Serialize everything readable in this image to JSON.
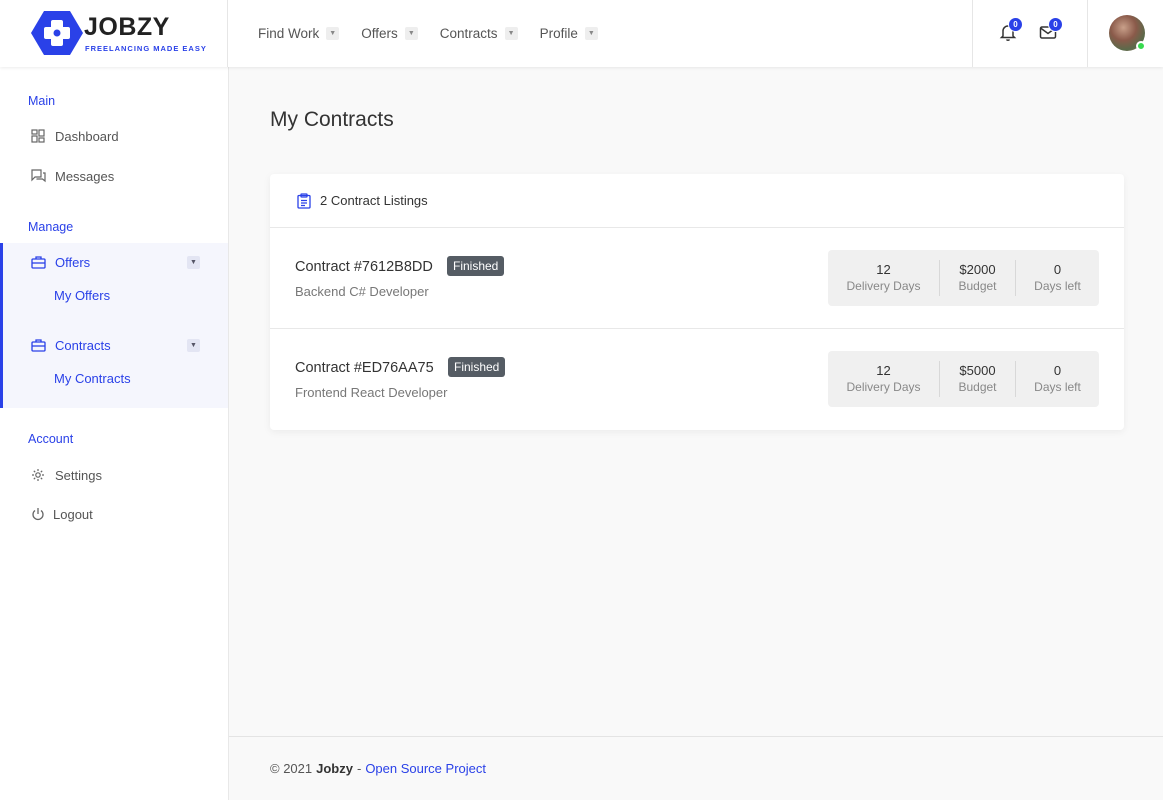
{
  "brand": {
    "name": "JOBZY",
    "tagline": "FREELANCING MADE EASY",
    "accent": "#2a41e8"
  },
  "nav": [
    {
      "label": "Find Work"
    },
    {
      "label": "Offers"
    },
    {
      "label": "Contracts"
    },
    {
      "label": "Profile"
    }
  ],
  "header": {
    "notifications_count": "0",
    "messages_count": "0"
  },
  "sidebar": {
    "main_title": "Main",
    "dashboard": "Dashboard",
    "messages": "Messages",
    "manage_title": "Manage",
    "offers": "Offers",
    "my_offers": "My Offers",
    "contracts": "Contracts",
    "my_contracts": "My Contracts",
    "account_title": "Account",
    "settings": "Settings",
    "logout": "Logout"
  },
  "page": {
    "title": "My Contracts",
    "listing_count": "2 Contract Listings"
  },
  "contracts": [
    {
      "title": "Contract #7612B8DD",
      "status": "Finished",
      "role": "Backend C# Developer",
      "delivery_days": "12",
      "delivery_label": "Delivery Days",
      "budget": "$2000",
      "budget_label": "Budget",
      "days_left": "0",
      "days_left_label": "Days left"
    },
    {
      "title": "Contract #ED76AA75",
      "status": "Finished",
      "role": "Frontend React Developer",
      "delivery_days": "12",
      "delivery_label": "Delivery Days",
      "budget": "$5000",
      "budget_label": "Budget",
      "days_left": "0",
      "days_left_label": "Days left"
    }
  ],
  "footer": {
    "copyright": "© 2021",
    "brand": "Jobzy",
    "separator": "-",
    "link": "Open Source Project"
  },
  "icons": {
    "logo": "hexagon-gamepad-icon",
    "notifications": "bell-icon",
    "messages": "envelope-icon",
    "dashboard": "grid-icon",
    "messages_nav": "chat-icon",
    "offers": "briefcase-icon",
    "contracts": "briefcase-icon",
    "settings": "gear-icon",
    "logout": "power-icon",
    "listings": "clipboard-icon"
  }
}
